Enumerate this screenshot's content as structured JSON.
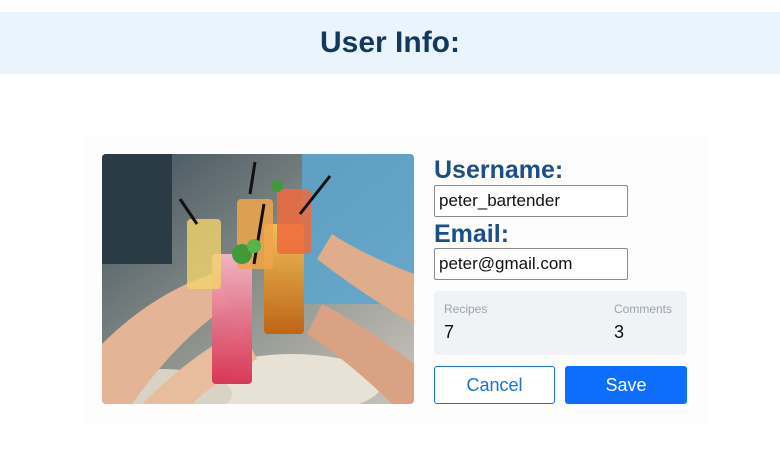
{
  "header": {
    "title": "User Info:"
  },
  "profile": {
    "photo_icon": "drinks-toast-photo",
    "username_label": "Username:",
    "username_value": "peter_bartender",
    "email_label": "Email:",
    "email_value": "peter@gmail.com"
  },
  "stats": {
    "recipes_label": "Recipes",
    "recipes_value": "7",
    "comments_label": "Comments",
    "comments_value": "3"
  },
  "actions": {
    "cancel_label": "Cancel",
    "save_label": "Save"
  },
  "colors": {
    "header_bg": "#e9f4fd",
    "title": "#12385e",
    "label": "#1b4f86",
    "primary": "#0d6efd"
  }
}
